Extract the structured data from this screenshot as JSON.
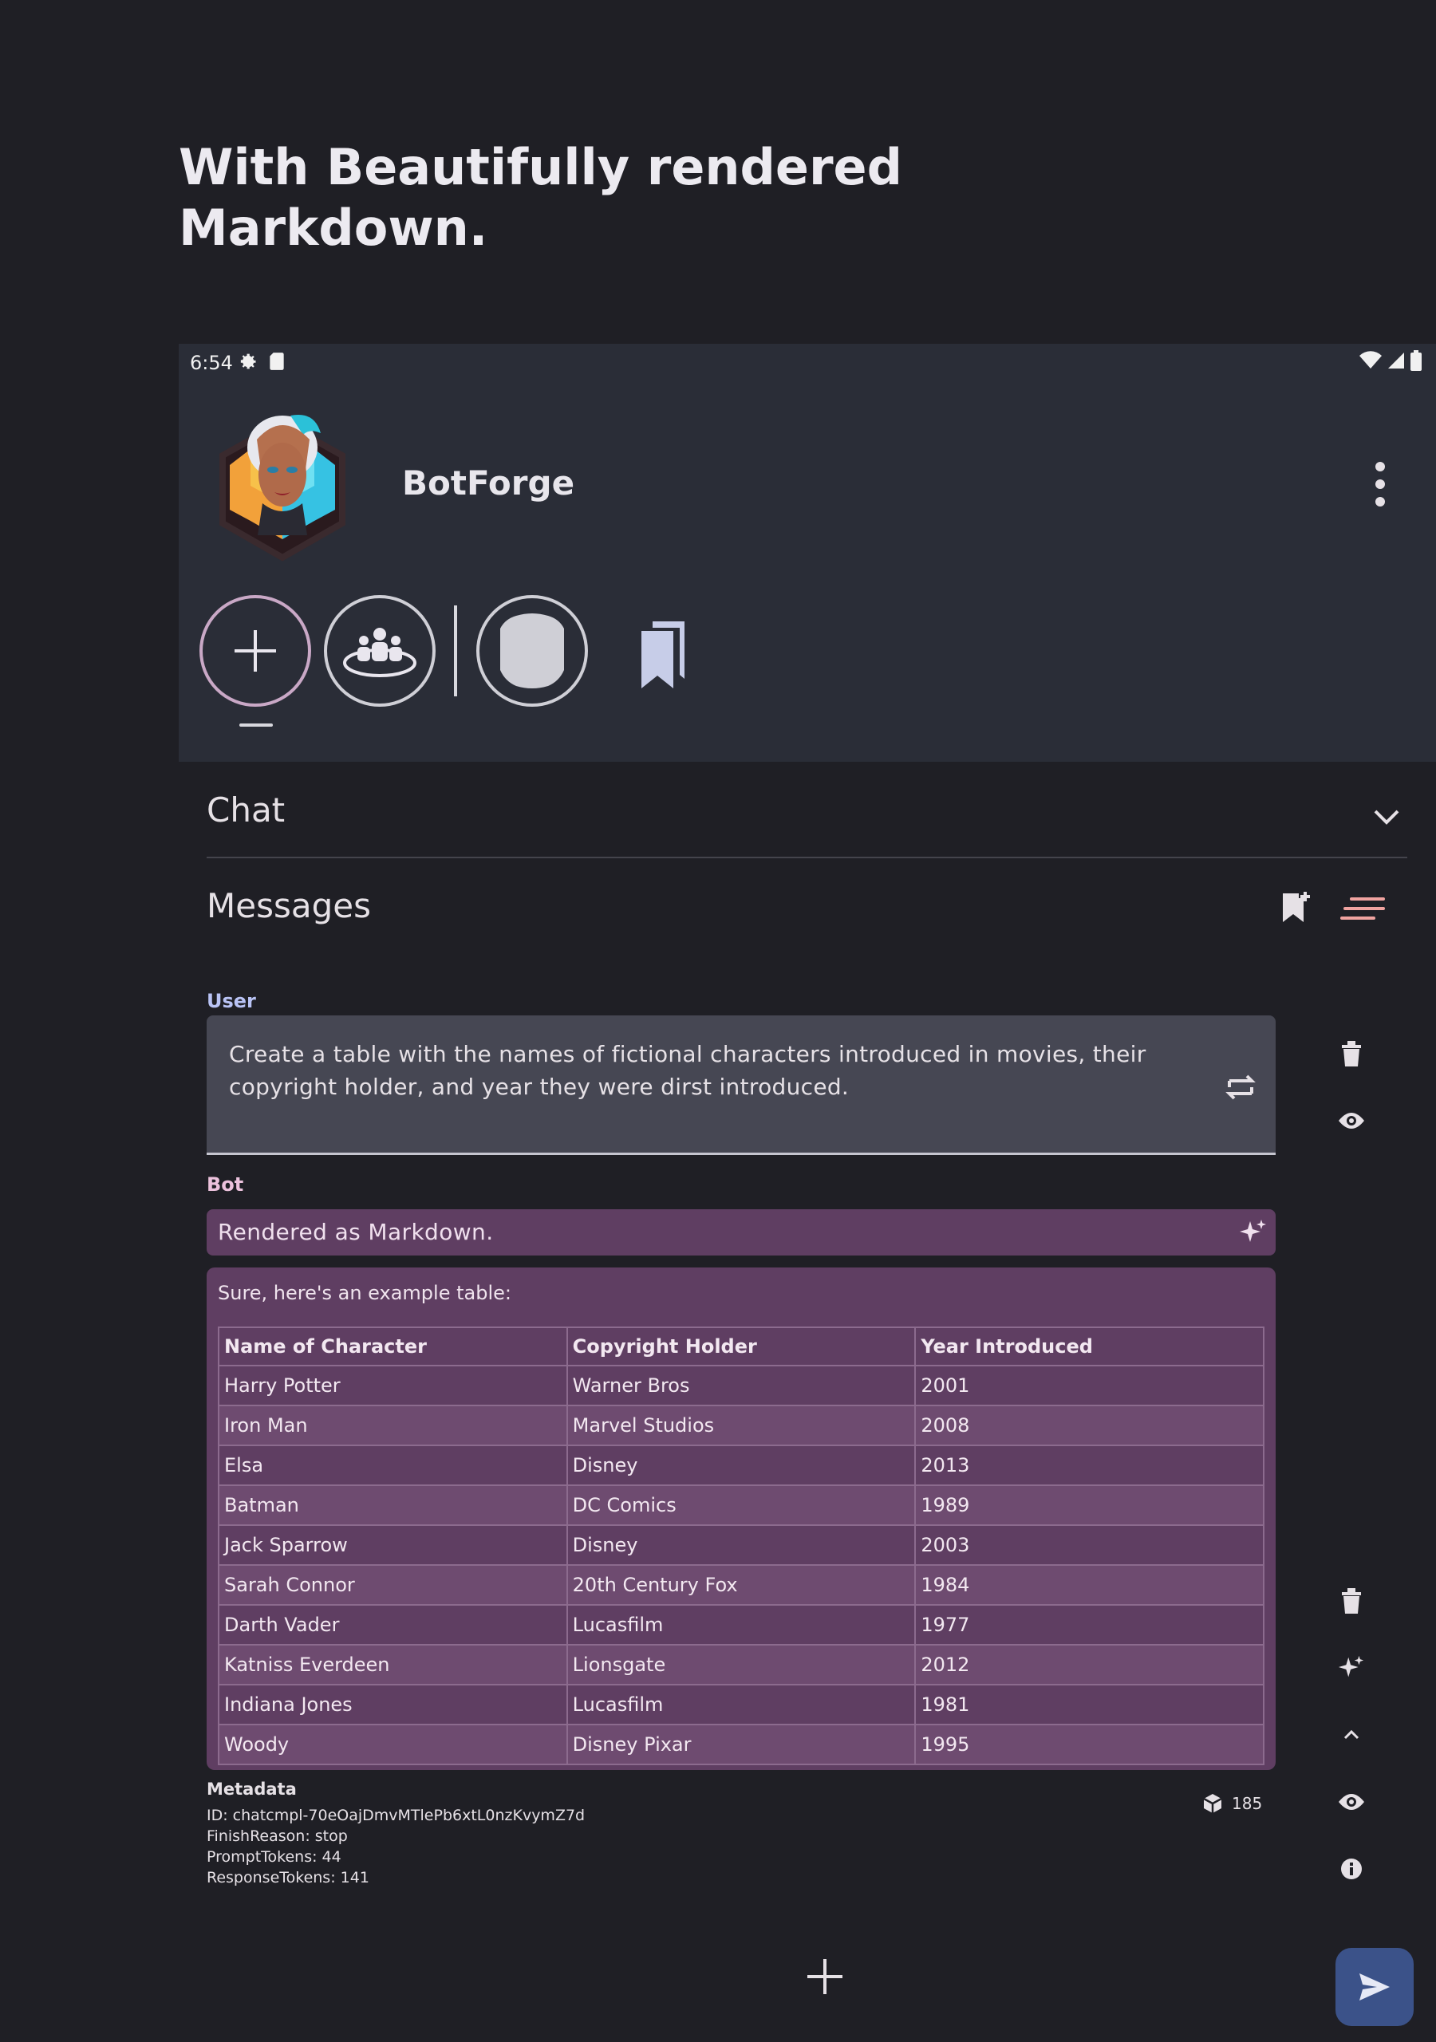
{
  "headline": "With Beautifully rendered Markdown.",
  "status_bar": {
    "time": "6:54"
  },
  "app": {
    "name": "BotForge"
  },
  "sections": {
    "chat": "Chat",
    "messages": "Messages"
  },
  "user_message": {
    "role": "User",
    "text": "Create a table with the names of fictional characters introduced in movies, their copyright holder, and year they were dirst introduced."
  },
  "bot_message": {
    "role": "Bot",
    "render_mode": "Rendered as Markdown.",
    "intro": "Sure, here's an example table:",
    "table": {
      "headers": [
        "Name of Character",
        "Copyright Holder",
        "Year Introduced"
      ],
      "rows": [
        [
          "Harry Potter",
          "Warner Bros",
          "2001"
        ],
        [
          "Iron Man",
          "Marvel Studios",
          "2008"
        ],
        [
          "Elsa",
          "Disney",
          "2013"
        ],
        [
          "Batman",
          "DC Comics",
          "1989"
        ],
        [
          "Jack Sparrow",
          "Disney",
          "2003"
        ],
        [
          "Sarah Connor",
          "20th Century Fox",
          "1984"
        ],
        [
          "Darth Vader",
          "Lucasfilm",
          "1977"
        ],
        [
          "Katniss Everdeen",
          "Lionsgate",
          "2012"
        ],
        [
          "Indiana Jones",
          "Lucasfilm",
          "1981"
        ],
        [
          "Woody",
          "Disney Pixar",
          "1995"
        ]
      ]
    }
  },
  "metadata": {
    "title": "Metadata",
    "lines": [
      "ID: chatcmpl-70eOajDmvMTlePb6xtL0nzKvymZ7d",
      "FinishReason: stop",
      "PromptTokens: 44",
      "ResponseTokens: 141"
    ],
    "token_total": "185"
  },
  "colors": {
    "background": "#1f1f25",
    "topbar": "#2a2d37",
    "bot_bubble": "#5f3e62",
    "user_bubble": "#464753",
    "send_button": "#3b5289",
    "sort_icon": "#f0a3a0"
  },
  "icons": [
    "settings-icon",
    "sd-card-icon",
    "wifi-icon",
    "signal-icon",
    "battery-icon",
    "more-vert-icon",
    "add-icon",
    "group-icon",
    "bot-icon",
    "bookmarks-icon",
    "chevron-down-icon",
    "bookmark-add-icon",
    "sort-icon",
    "delete-icon",
    "visibility-icon",
    "swap-icon",
    "sparkle-icon",
    "chevron-up-icon",
    "info-icon",
    "token-icon",
    "send-icon"
  ]
}
